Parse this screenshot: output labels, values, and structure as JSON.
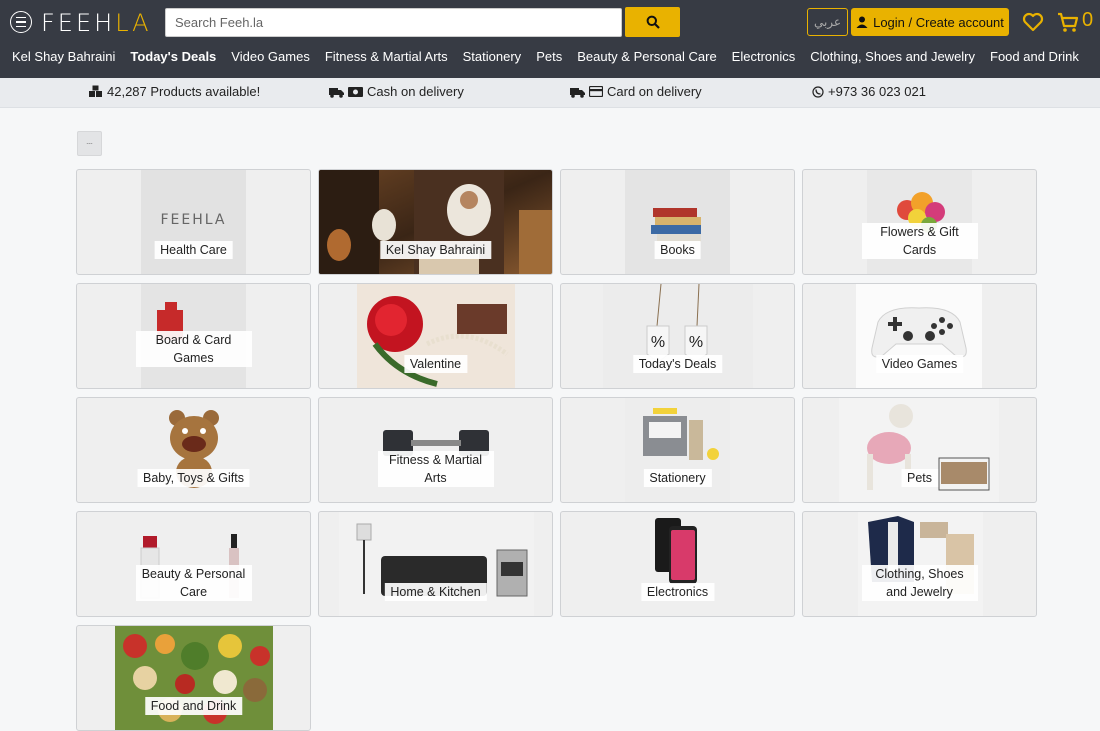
{
  "header": {
    "logo_main": "FEEH",
    "logo_accent": "LA",
    "search_placeholder": "Search Feeh.la",
    "lang_label": "عربي",
    "login_label": "Login / Create account",
    "cart_count": "0"
  },
  "nav": [
    "Kel Shay Bahraini",
    "Today's Deals",
    "Video Games",
    "Fitness & Martial Arts",
    "Stationery",
    "Pets",
    "Beauty & Personal Care",
    "Electronics",
    "Clothing, Shoes and Jewelry",
    "Food and Drink"
  ],
  "info": {
    "products": "42,287 Products available!",
    "cash": "Cash on delivery",
    "card": "Card on delivery",
    "phone": "+973 36 023 021"
  },
  "breadcrumb": "---",
  "tiles": [
    {
      "label": "Health Care",
      "logo": "FEEHLA"
    },
    {
      "label": "Kel Shay Bahraini"
    },
    {
      "label": "Books"
    },
    {
      "label": "Flowers & Gift Cards"
    },
    {
      "label": "Board & Card Games"
    },
    {
      "label": "Valentine"
    },
    {
      "label": "Today's Deals"
    },
    {
      "label": "Video Games"
    },
    {
      "label": "Baby, Toys & Gifts"
    },
    {
      "label": "Fitness & Martial Arts"
    },
    {
      "label": "Stationery"
    },
    {
      "label": "Pets"
    },
    {
      "label": "Beauty & Personal Care"
    },
    {
      "label": "Home & Kitchen"
    },
    {
      "label": "Electronics"
    },
    {
      "label": "Clothing, Shoes and Jewelry"
    },
    {
      "label": "Food and Drink"
    }
  ],
  "colors": {
    "accent": "#e9b200",
    "header": "#373b44",
    "infobar": "#e9ebee"
  }
}
